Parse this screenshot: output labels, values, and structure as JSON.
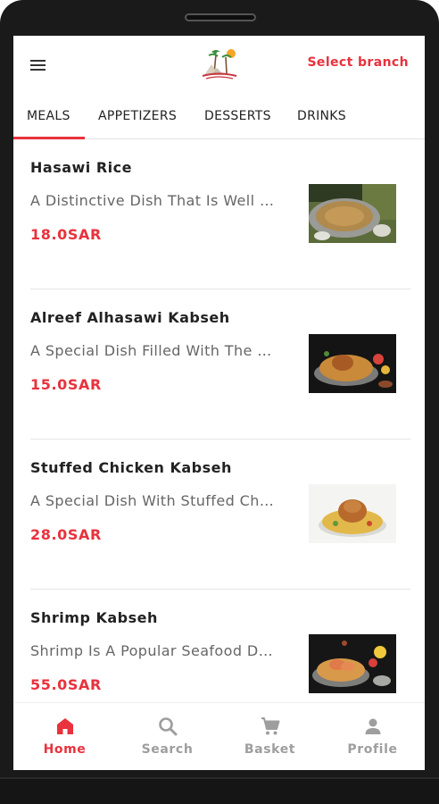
{
  "header": {
    "select_branch": "Select branch"
  },
  "tabs": [
    {
      "label": "MEALS",
      "active": true
    },
    {
      "label": "APPETIZERS",
      "active": false
    },
    {
      "label": "DESSERTS",
      "active": false
    },
    {
      "label": "DRINKS",
      "active": false
    }
  ],
  "items": [
    {
      "name": "Hasawi Rice",
      "description": "A Distinctive Dish That Is Well …",
      "price": "18.0SAR"
    },
    {
      "name": "Alreef Alhasawi Kabseh",
      "description": "A Special Dish Filled With The …",
      "price": "15.0SAR"
    },
    {
      "name": "Stuffed Chicken Kabseh",
      "description": "A Special Dish With Stuffed Ch…",
      "price": "28.0SAR"
    },
    {
      "name": "Shrimp Kabseh",
      "description": "Shrimp Is A Popular Seafood D…",
      "price": "55.0SAR"
    }
  ],
  "bottom_nav": [
    {
      "label": "Home",
      "icon": "home-icon",
      "active": true
    },
    {
      "label": "Search",
      "icon": "search-icon",
      "active": false
    },
    {
      "label": "Basket",
      "icon": "cart-icon",
      "active": false
    },
    {
      "label": "Profile",
      "icon": "profile-icon",
      "active": false
    }
  ],
  "colors": {
    "accent": "#e8323d",
    "inactive": "#9e9e9e",
    "text": "#222222"
  }
}
